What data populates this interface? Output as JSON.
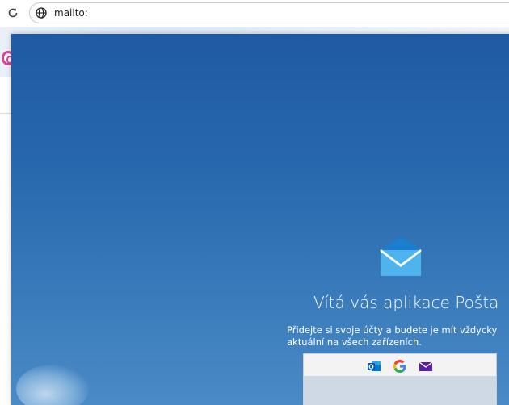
{
  "browser": {
    "address": "mailto:"
  },
  "mail_app": {
    "title": "Vítá vás aplikace Pošta",
    "description": "Přidejte si svoje účty a budete je mít vždycky aktuální na všech zařízeních.",
    "providers": [
      "outlook-icon",
      "google-icon",
      "mail-icon"
    ]
  },
  "colors": {
    "window_gradient_top": "#1f5aa2",
    "window_gradient_bottom": "#4a8ac5",
    "envelope": "#4fb3ee"
  }
}
